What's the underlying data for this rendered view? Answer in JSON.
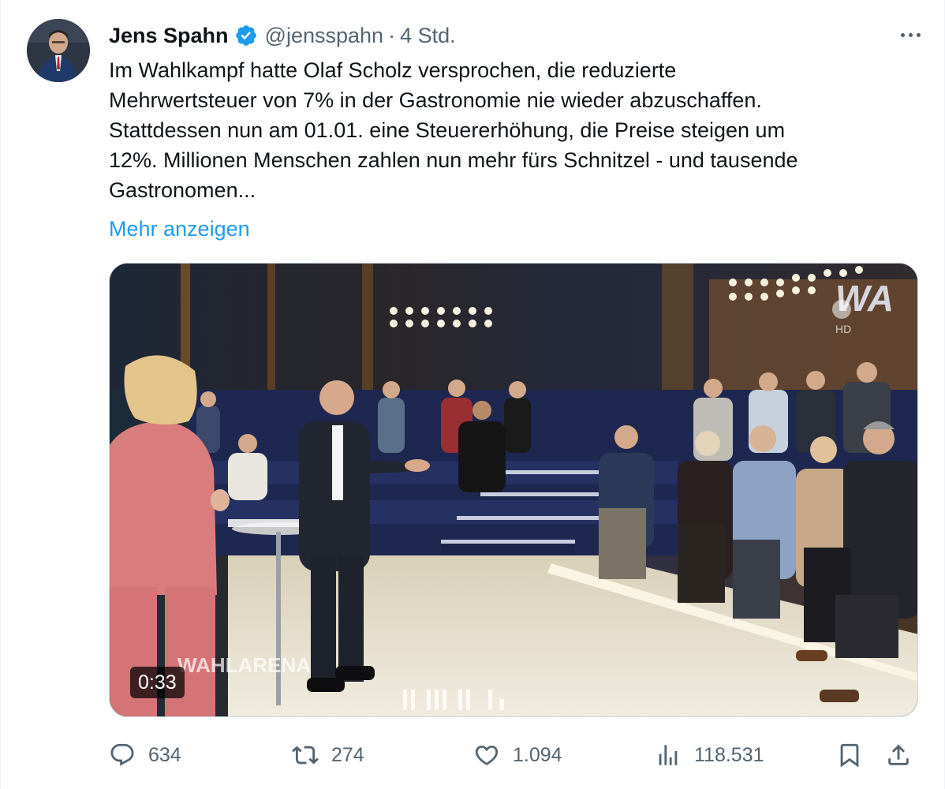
{
  "author": {
    "name": "Jens Spahn",
    "handle": "@jensspahn",
    "separator": "·",
    "time": "4 Std.",
    "verified": true
  },
  "tweet": {
    "lines": [
      "Im Wahlkampf hatte Olaf Scholz versprochen, die reduzierte",
      "Mehrwertsteuer von 7% in der Gastronomie nie wieder abzuschaffen.",
      "Stattdessen nun am 01.01. eine Steuererhöhung, die Preise steigen um",
      "12%. Millionen Menschen zahlen nun mehr fürs Schnitzel - und tausende",
      "Gastronomen..."
    ],
    "show_more": "Mehr anzeigen"
  },
  "media": {
    "type": "video",
    "duration": "0:33",
    "overlay_brand": "WAHLARENA",
    "corner_logo": "WA",
    "channel": "HD"
  },
  "actions": {
    "replies": "634",
    "reposts": "274",
    "likes": "1.094",
    "views": "118.531"
  },
  "colors": {
    "text": "#0f1419",
    "secondary": "#536471",
    "link": "#1d9bf0",
    "verified": "#1d9bf0"
  }
}
